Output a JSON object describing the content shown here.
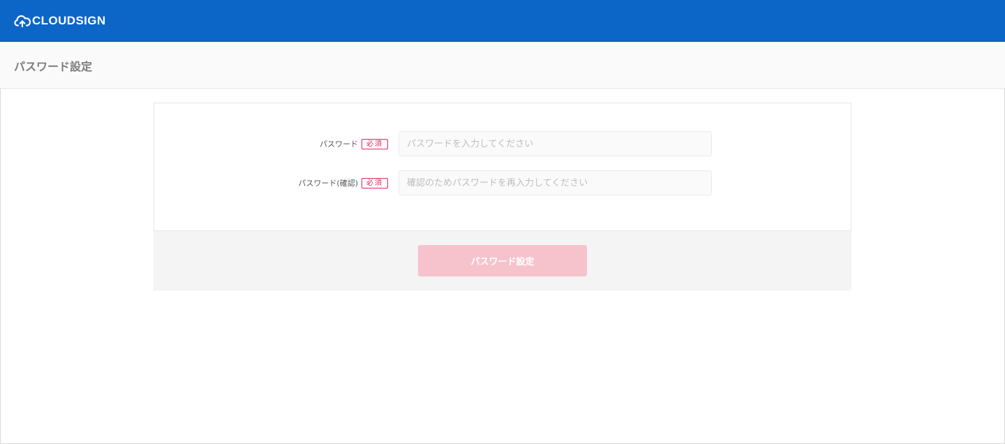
{
  "header": {
    "brand": "CLOUDSIGN",
    "logo_icon": "cloud-upload-icon",
    "color": "#0c66c8"
  },
  "page": {
    "title": "パスワード設定"
  },
  "form": {
    "required_badge": "必須",
    "password": {
      "label": "パスワード",
      "placeholder": "パスワードを入力してください",
      "value": ""
    },
    "password_confirm": {
      "label": "パスワード(確認)",
      "placeholder": "確認のためパスワードを再入力してください",
      "value": ""
    },
    "submit_label": "パスワード設定",
    "submit_color": "#f6c3cd",
    "required_color": "#e0245e"
  }
}
